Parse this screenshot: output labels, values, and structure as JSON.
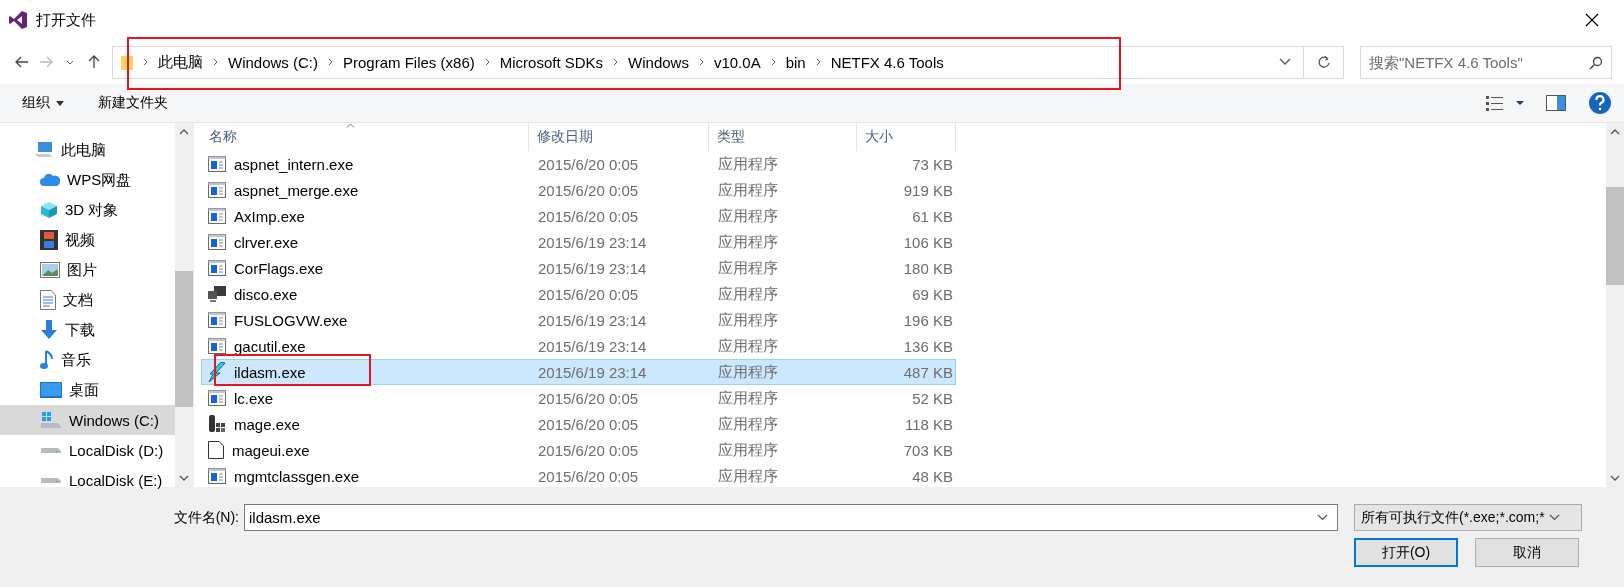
{
  "window": {
    "title": "打开文件"
  },
  "address": {
    "segments": [
      "此电脑",
      "Windows (C:)",
      "Program Files (x86)",
      "Microsoft SDKs",
      "Windows",
      "v10.0A",
      "bin",
      "NETFX 4.6 Tools"
    ]
  },
  "search": {
    "placeholder": "搜索\"NETFX 4.6 Tools\""
  },
  "toolbar": {
    "organize": "组织",
    "new_folder": "新建文件夹"
  },
  "sidebar": {
    "items": [
      {
        "label": "此电脑",
        "kind": "pc",
        "selected": false,
        "children": [
          {
            "label": "WPS网盘",
            "kind": "cloud",
            "selected": false
          },
          {
            "label": "3D 对象",
            "kind": "cube",
            "selected": false
          },
          {
            "label": "视频",
            "kind": "film",
            "selected": false
          },
          {
            "label": "图片",
            "kind": "image",
            "selected": false
          },
          {
            "label": "文档",
            "kind": "doc",
            "selected": false
          },
          {
            "label": "下载",
            "kind": "download",
            "selected": false
          },
          {
            "label": "音乐",
            "kind": "music",
            "selected": false
          },
          {
            "label": "桌面",
            "kind": "desktop",
            "selected": false
          },
          {
            "label": "Windows (C:)",
            "kind": "windrive",
            "selected": true
          },
          {
            "label": "LocalDisk (D:)",
            "kind": "drive",
            "selected": false
          },
          {
            "label": "LocalDisk (E:)",
            "kind": "drive",
            "selected": false
          }
        ]
      }
    ]
  },
  "table": {
    "columns": [
      "名称",
      "修改日期",
      "类型",
      "大小"
    ],
    "rows": [
      {
        "name": "aspnet_intern.exe",
        "date": "2015/6/20 0:05",
        "type": "应用程序",
        "size": "73 KB",
        "kind": "app",
        "selected": false
      },
      {
        "name": "aspnet_merge.exe",
        "date": "2015/6/20 0:05",
        "type": "应用程序",
        "size": "919 KB",
        "kind": "app",
        "selected": false
      },
      {
        "name": "AxImp.exe",
        "date": "2015/6/20 0:05",
        "type": "应用程序",
        "size": "61 KB",
        "kind": "app",
        "selected": false
      },
      {
        "name": "clrver.exe",
        "date": "2015/6/19 23:14",
        "type": "应用程序",
        "size": "106 KB",
        "kind": "app",
        "selected": false
      },
      {
        "name": "CorFlags.exe",
        "date": "2015/6/19 23:14",
        "type": "应用程序",
        "size": "180 KB",
        "kind": "app",
        "selected": false
      },
      {
        "name": "disco.exe",
        "date": "2015/6/20 0:05",
        "type": "应用程序",
        "size": "69 KB",
        "kind": "monitors",
        "selected": false
      },
      {
        "name": "FUSLOGVW.exe",
        "date": "2015/6/19 23:14",
        "type": "应用程序",
        "size": "196 KB",
        "kind": "app",
        "selected": false
      },
      {
        "name": "gacutil.exe",
        "date": "2015/6/19 23:14",
        "type": "应用程序",
        "size": "136 KB",
        "kind": "app",
        "selected": false
      },
      {
        "name": "ildasm.exe",
        "date": "2015/6/19 23:14",
        "type": "应用程序",
        "size": "487 KB",
        "kind": "bolt",
        "selected": true
      },
      {
        "name": "lc.exe",
        "date": "2015/6/20 0:05",
        "type": "应用程序",
        "size": "52 KB",
        "kind": "app",
        "selected": false
      },
      {
        "name": "mage.exe",
        "date": "2015/6/20 0:05",
        "type": "应用程序",
        "size": "118 KB",
        "kind": "tool",
        "selected": false
      },
      {
        "name": "mageui.exe",
        "date": "2015/6/20 0:05",
        "type": "应用程序",
        "size": "703 KB",
        "kind": "page",
        "selected": false
      },
      {
        "name": "mgmtclassgen.exe",
        "date": "2015/6/20 0:05",
        "type": "应用程序",
        "size": "48 KB",
        "kind": "app",
        "selected": false
      }
    ]
  },
  "filename": {
    "label": "文件名(N):",
    "value": "ildasm.exe"
  },
  "filetype": {
    "value": "所有可执行文件(*.exe;*.com;*"
  },
  "buttons": [
    {
      "label": "打开(O)",
      "default": true
    },
    {
      "label": "取消",
      "default": false
    }
  ]
}
